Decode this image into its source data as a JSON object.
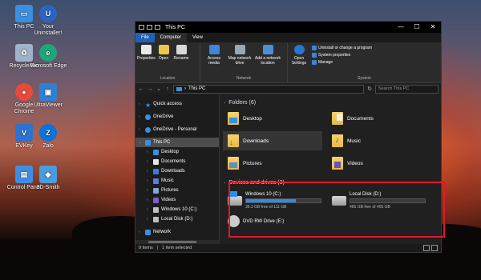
{
  "desktop": {
    "icons": [
      {
        "label": "This PC",
        "icon": "this-pc-icon",
        "color": "#3a8fe0"
      },
      {
        "label": "Your Uninstaller!",
        "icon": "uninstaller-icon",
        "color": "#2b64c4"
      },
      {
        "label": "Recycle Bin",
        "icon": "recycle-bin-icon",
        "color": "#9fb3c8"
      },
      {
        "label": "Microsoft Edge",
        "icon": "edge-icon",
        "color": "#1fa67a"
      },
      {
        "label": "Google Chrome",
        "icon": "chrome-icon",
        "color": "#e64a3b"
      },
      {
        "label": "UltraViewer",
        "icon": "ultraviewer-icon",
        "color": "#2e80d6"
      },
      {
        "label": "EVKey",
        "icon": "evkey-icon",
        "color": "#2b73d0"
      },
      {
        "label": "Zalo",
        "icon": "zalo-icon",
        "color": "#0a72d8"
      },
      {
        "label": "Control Panel",
        "icon": "control-panel-icon",
        "color": "#3e8ee6"
      },
      {
        "label": "3D-Smith",
        "icon": "app-icon",
        "color": "#4a9be0"
      }
    ]
  },
  "window": {
    "title": "This PC",
    "controls": {
      "minimize": "—",
      "maximize": "☐",
      "close": "✕"
    },
    "tabs": [
      "File",
      "Computer",
      "View"
    ],
    "ribbon": {
      "location": {
        "label": "Location",
        "buttons": [
          "Properties",
          "Open",
          "Rename"
        ]
      },
      "network": {
        "label": "Network",
        "buttons": [
          "Access media",
          "Map network drive",
          "Add a network location"
        ]
      },
      "system": {
        "label": "System",
        "open_settings": "Open Settings",
        "items": [
          "Uninstall or change a program",
          "System properties",
          "Manage"
        ]
      }
    },
    "address": {
      "path": "This PC",
      "search_placeholder": "Search This PC"
    },
    "nav": {
      "quick_access": "Quick access",
      "onedrive": "OneDrive",
      "onedrive_personal": "OneDrive - Personal",
      "this_pc": "This PC",
      "children": [
        "Desktop",
        "Documents",
        "Downloads",
        "Music",
        "Pictures",
        "Videos",
        "Windows 10 (C:)",
        "Local Disk (D:)"
      ],
      "network": "Network"
    },
    "folders": {
      "header": "Folders (6)",
      "items": [
        "Desktop",
        "Documents",
        "Downloads",
        "Music",
        "Pictures",
        "Videos"
      ]
    },
    "devices": {
      "header": "Devices and drives (3)",
      "drives": [
        {
          "name": "Windows 10 (C:)",
          "free": "36.3 GB free of 111 GB",
          "used_fraction": 0.67
        },
        {
          "name": "Local Disk (D:)",
          "free": "465 GB free of 465 GB",
          "used_fraction": 0.0
        },
        {
          "name": "DVD RW Drive (E:)"
        }
      ]
    },
    "status": {
      "items": "9 items",
      "selected": "1 item selected"
    }
  },
  "colors": {
    "accent": "#1d62b8",
    "highlight_border": "#e0192a"
  }
}
